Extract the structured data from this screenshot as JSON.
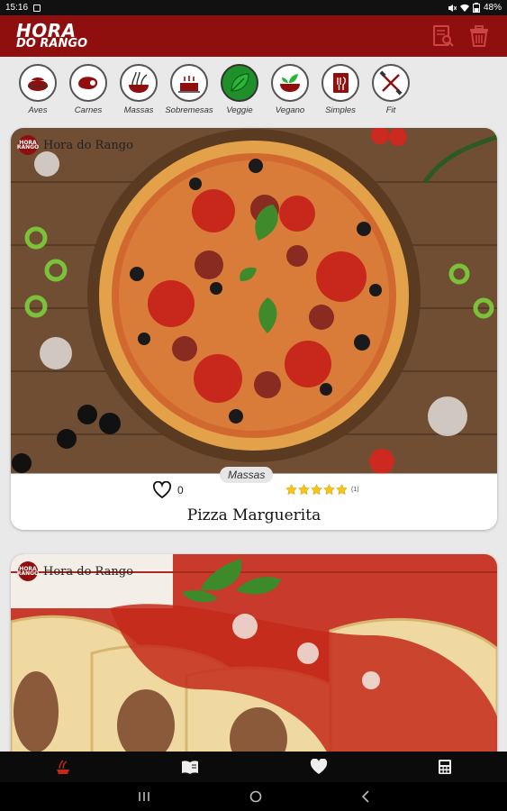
{
  "status_bar": {
    "time": "15:16",
    "battery": "48%"
  },
  "app_bar": {
    "logo_line1": "HORA",
    "logo_line2": "DO RANGO"
  },
  "categories": [
    {
      "label": "Aves",
      "icon": "chicken-icon"
    },
    {
      "label": "Carnes",
      "icon": "meat-icon"
    },
    {
      "label": "Massas",
      "icon": "pasta-icon"
    },
    {
      "label": "Sobremesas",
      "icon": "cake-icon"
    },
    {
      "label": "Veggie",
      "icon": "leaf-icon"
    },
    {
      "label": "Vegano",
      "icon": "vegan-bowl-icon"
    },
    {
      "label": "Simples",
      "icon": "cookbook-icon"
    },
    {
      "label": "Fit",
      "icon": "dumbbell-icon"
    }
  ],
  "cards": [
    {
      "brand": "Hora do Rango",
      "category": "Massas",
      "likes": "0",
      "rating_count": "(1)",
      "title": "Pizza Marguerita"
    },
    {
      "brand": "Hora do Rango"
    }
  ],
  "colors": {
    "primary": "#8f0f0f",
    "star": "#f5c518",
    "veggie": "#1f8f2a"
  }
}
